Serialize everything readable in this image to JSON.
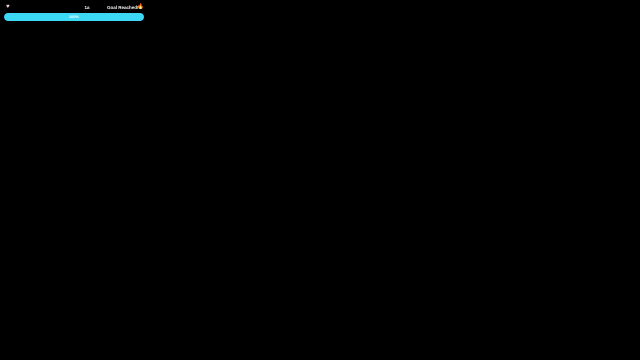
{
  "goal_widget": {
    "left_icon": "heart-icon",
    "count": "1a",
    "status": "Goal Reached!",
    "right_icon": "flame-icon",
    "progress_label": "100%",
    "progress_fraction": 1.0,
    "colors": {
      "background": "#000000",
      "track": "#1b7f95",
      "fill": "#3dd8f4",
      "text": "#ffffff",
      "left_icon": "#ffd6e6"
    }
  }
}
